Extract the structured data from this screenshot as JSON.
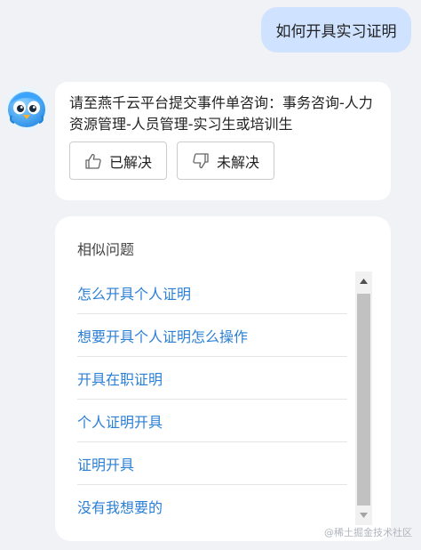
{
  "user_message": {
    "text": "如何开具实习证明"
  },
  "bot_answer": {
    "text": "请至燕千云平台提交事件单咨询：事务咨询-人力资源管理-人员管理-实习生或培训生",
    "feedback": {
      "resolved_label": "已解决",
      "unresolved_label": "未解决"
    }
  },
  "similar_questions": {
    "title": "相似问题",
    "items": [
      {
        "label": "怎么开具个人证明"
      },
      {
        "label": "想要开具个人证明怎么操作"
      },
      {
        "label": "开具在职证明"
      },
      {
        "label": "个人证明开具"
      },
      {
        "label": "证明开具"
      },
      {
        "label": "没有我想要的"
      }
    ]
  },
  "watermark": "@稀土掘金技术社区",
  "icons": {
    "avatar": "bird-avatar-icon",
    "resolved": "thumbs-up-icon",
    "unresolved": "thumbs-down-icon",
    "scroll_up": "triangle-up-icon",
    "scroll_down": "triangle-down-icon"
  },
  "colors": {
    "page_bg": "#f1f2f5",
    "user_bubble": "#cfe2ff",
    "link": "#2b7fd4"
  }
}
